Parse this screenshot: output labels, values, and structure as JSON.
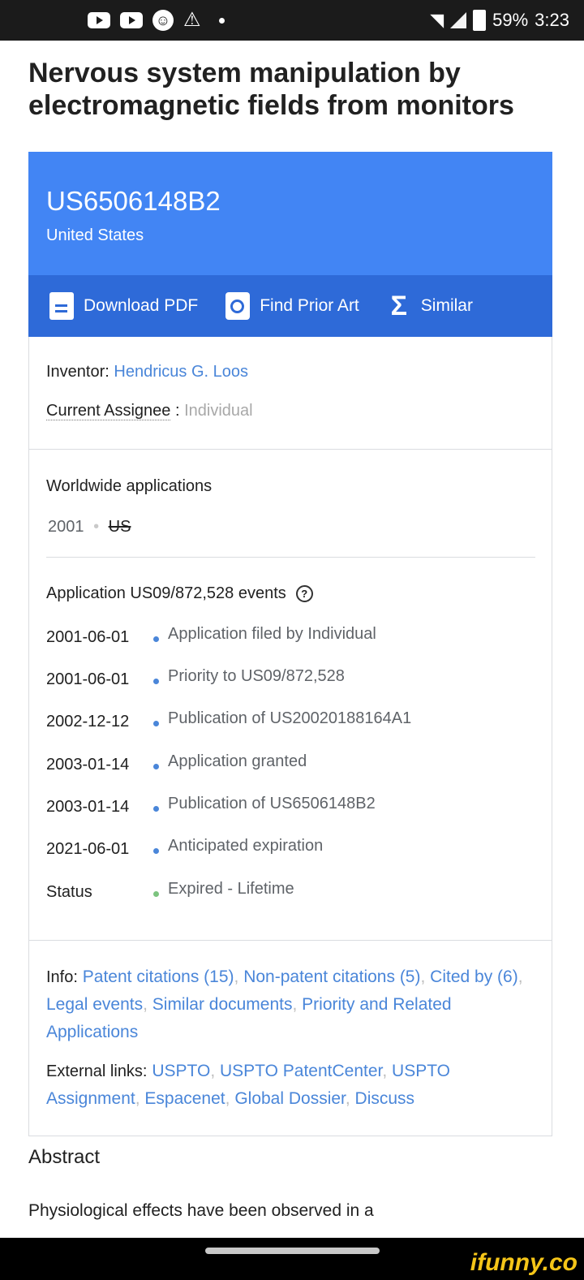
{
  "status_bar": {
    "battery": "59%",
    "time": "3:23",
    "icons": [
      "youtube-icon",
      "youtube-icon",
      "smiley-icon",
      "warning-icon",
      "dot-icon",
      "wifi-icon",
      "signal-icon",
      "battery-icon"
    ]
  },
  "page": {
    "title": "Nervous system manipulation by electromagnetic fields from monitors"
  },
  "patent": {
    "number": "US6506148B2",
    "country": "United States",
    "actions": {
      "download": "Download PDF",
      "prior_art": "Find Prior Art",
      "similar": "Similar"
    },
    "accent_color": "#4285f4",
    "action_bar_color": "#2e6ad8"
  },
  "people": {
    "inventor_label": "Inventor:",
    "inventor": "Hendricus G. Loos",
    "assignee_label": "Current Assignee",
    "assignee_colon": ":",
    "assignee": "Individual"
  },
  "worldwide": {
    "title": "Worldwide applications",
    "year": "2001",
    "separator": "•",
    "country": "US"
  },
  "events": {
    "title": "Application US09/872,528 events",
    "help": "?",
    "items": [
      {
        "date": "2001-06-01",
        "text": "Application filed by Individual"
      },
      {
        "date": "2001-06-01",
        "text": "Priority to US09/872,528"
      },
      {
        "date": "2002-12-12",
        "text": "Publication of US20020188164A1"
      },
      {
        "date": "2003-01-14",
        "text": "Application granted"
      },
      {
        "date": "2003-01-14",
        "text": "Publication of US6506148B2"
      },
      {
        "date": "2021-06-01",
        "text": "Anticipated expiration"
      },
      {
        "date": "Status",
        "text": "Expired - Lifetime"
      }
    ]
  },
  "info": {
    "label": "Info:",
    "links": [
      "Patent citations (15)",
      "Non-patent citations (5)",
      "Cited by (6)",
      "Legal events",
      "Similar documents",
      "Priority and Related Applications"
    ]
  },
  "external": {
    "label": "External links:",
    "links": [
      "USPTO",
      "USPTO PatentCenter",
      "USPTO Assignment",
      "Espacenet",
      "Global Dossier",
      "Discuss"
    ]
  },
  "abstract": {
    "heading": "Abstract",
    "text": "Physiological effects have been observed in a"
  },
  "watermark": "ifunny.co"
}
